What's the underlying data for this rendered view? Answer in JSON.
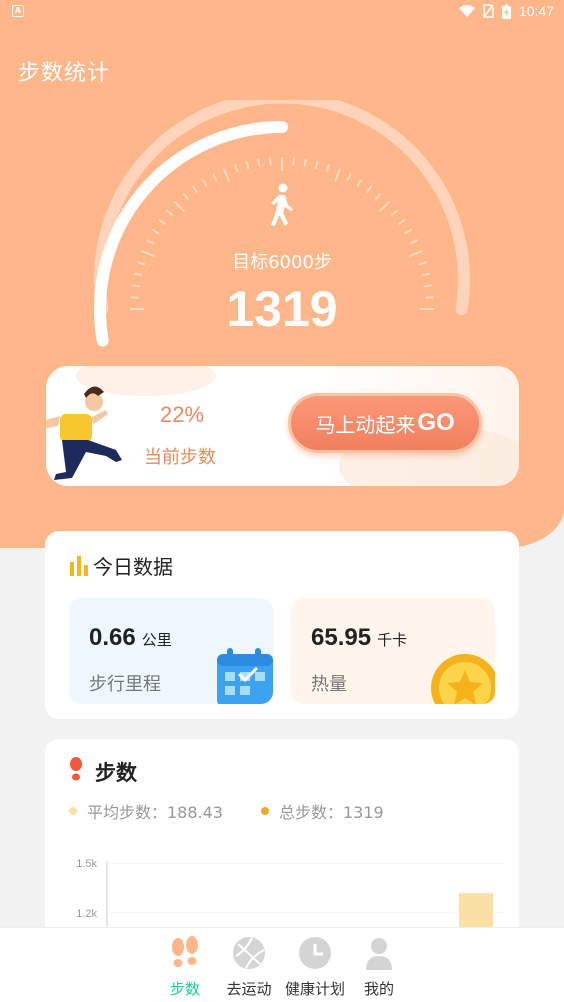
{
  "status_bar": {
    "time": "10:47"
  },
  "header": {
    "title": "步数统计"
  },
  "gauge": {
    "goal_label": "目标6000步",
    "current_steps": "1319",
    "progress_fraction": 0.22
  },
  "progress_card": {
    "percent": "22%",
    "label": "当前步数",
    "button_label": "马上动起来",
    "button_suffix": "GO"
  },
  "today": {
    "title": "今日数据",
    "distance": {
      "value": "0.66",
      "unit": "公里",
      "label": "步行里程"
    },
    "calories": {
      "value": "65.95",
      "unit": "千卡",
      "label": "热量"
    }
  },
  "steps_section": {
    "title": "步数",
    "average_label": "平均步数：188.43",
    "total_label": "总步数：1319",
    "colors": {
      "average": "#fbe0a6",
      "total": "#f4a623"
    }
  },
  "chart_data": {
    "type": "bar",
    "y_ticks": [
      "1.5k",
      "1.2k"
    ],
    "ylim": [
      1200,
      1500
    ],
    "values": [
      1319
    ]
  },
  "tabbar": {
    "items": [
      {
        "label": "步数",
        "icon": "footprints-icon",
        "active": true
      },
      {
        "label": "去运动",
        "icon": "ball-icon",
        "active": false
      },
      {
        "label": "健康计划",
        "icon": "clock-icon",
        "active": false
      },
      {
        "label": "我的",
        "icon": "person-icon",
        "active": false
      }
    ]
  },
  "colors": {
    "hero": "#ffb689",
    "accent": "#e58c5e",
    "active_tab": "#20c997"
  }
}
